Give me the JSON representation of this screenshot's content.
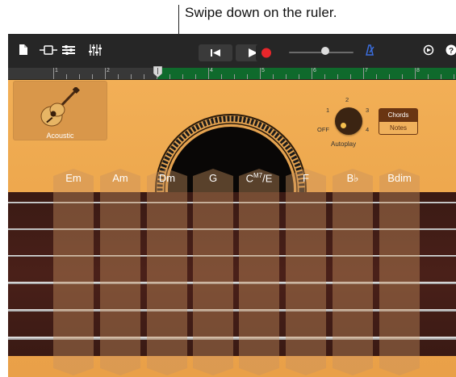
{
  "callout": {
    "text": "Swipe down on the ruler."
  },
  "toolbar": {
    "icons": [
      "document-icon",
      "tracks-view-icon",
      "track-controls-icon",
      "mixer-icon",
      "go-to-start-icon",
      "play-icon",
      "record-icon",
      "master-volume-slider",
      "metronome-icon",
      "tempo-icon",
      "help-icon"
    ],
    "accent_record": "#e8262b",
    "metronome_color": "#3b6fe0"
  },
  "ruler": {
    "bars": [
      "1",
      "2",
      "3",
      "4",
      "5",
      "6",
      "7",
      "8"
    ]
  },
  "instrument": {
    "label": "Acoustic"
  },
  "autoplay": {
    "label": "Autoplay",
    "positions": [
      "OFF",
      "1",
      "2",
      "3",
      "4"
    ],
    "selected": "OFF"
  },
  "mode_toggle": {
    "chords_label": "Chords",
    "notes_label": "Notes",
    "selected": "Chords"
  },
  "chords": [
    {
      "label": "Em"
    },
    {
      "label": "Am"
    },
    {
      "label": "Dm"
    },
    {
      "label": "G"
    },
    {
      "label": "C",
      "sup": "M7",
      "suffix": "/E"
    },
    {
      "label": "F"
    },
    {
      "label": "B♭"
    },
    {
      "label": "Bdim"
    }
  ]
}
